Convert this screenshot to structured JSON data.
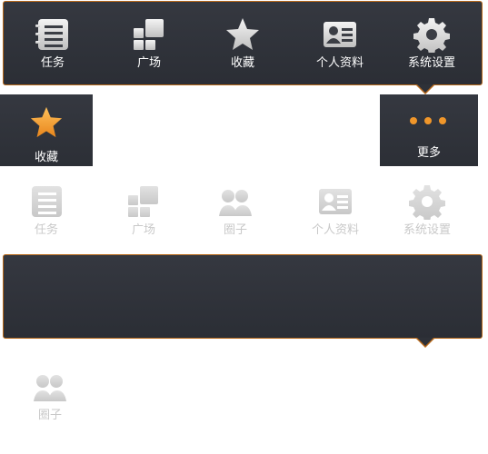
{
  "top_menu": {
    "items": [
      {
        "label": "任务",
        "icon": "list-icon"
      },
      {
        "label": "广场",
        "icon": "grid-icon"
      },
      {
        "label": "收藏",
        "icon": "star-icon"
      },
      {
        "label": "个人资料",
        "icon": "id-card-icon"
      },
      {
        "label": "系统设置",
        "icon": "gear-icon"
      }
    ]
  },
  "tile_favorite": {
    "label": "收藏",
    "icon": "star-icon"
  },
  "tile_more": {
    "label": "更多",
    "icon": "more-dots-icon"
  },
  "light_row": {
    "items": [
      {
        "label": "任务",
        "icon": "list-icon"
      },
      {
        "label": "广场",
        "icon": "grid-icon"
      },
      {
        "label": "圈子",
        "icon": "group-icon"
      },
      {
        "label": "个人资料",
        "icon": "id-card-icon"
      },
      {
        "label": "系统设置",
        "icon": "gear-icon"
      }
    ]
  },
  "bottom_item": {
    "label": "圈子",
    "icon": "group-icon"
  },
  "colors": {
    "panel": "#30333a",
    "border": "#b86a1c",
    "accent_orange": "#f0962a",
    "icon_light": "#d4d4d4"
  }
}
